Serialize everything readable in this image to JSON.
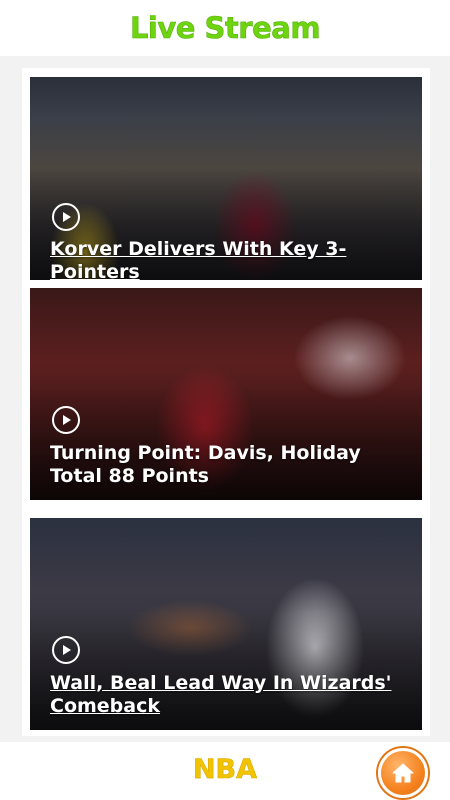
{
  "header": {
    "title": "Live Stream"
  },
  "cards": [
    {
      "headline": "Korver Delivers With Key 3-Pointers"
    },
    {
      "headline": "Turning Point: Davis, Holiday Total 88 Points"
    },
    {
      "headline": "Wall, Beal Lead Way In Wizards' Comeback"
    }
  ],
  "footer": {
    "label": "NBA"
  },
  "icons": {
    "play": "play-icon",
    "home": "home-icon"
  },
  "colors": {
    "title_green": "#6dd40f",
    "footer_yellow": "#f2c400",
    "home_orange": "#f5821f"
  }
}
